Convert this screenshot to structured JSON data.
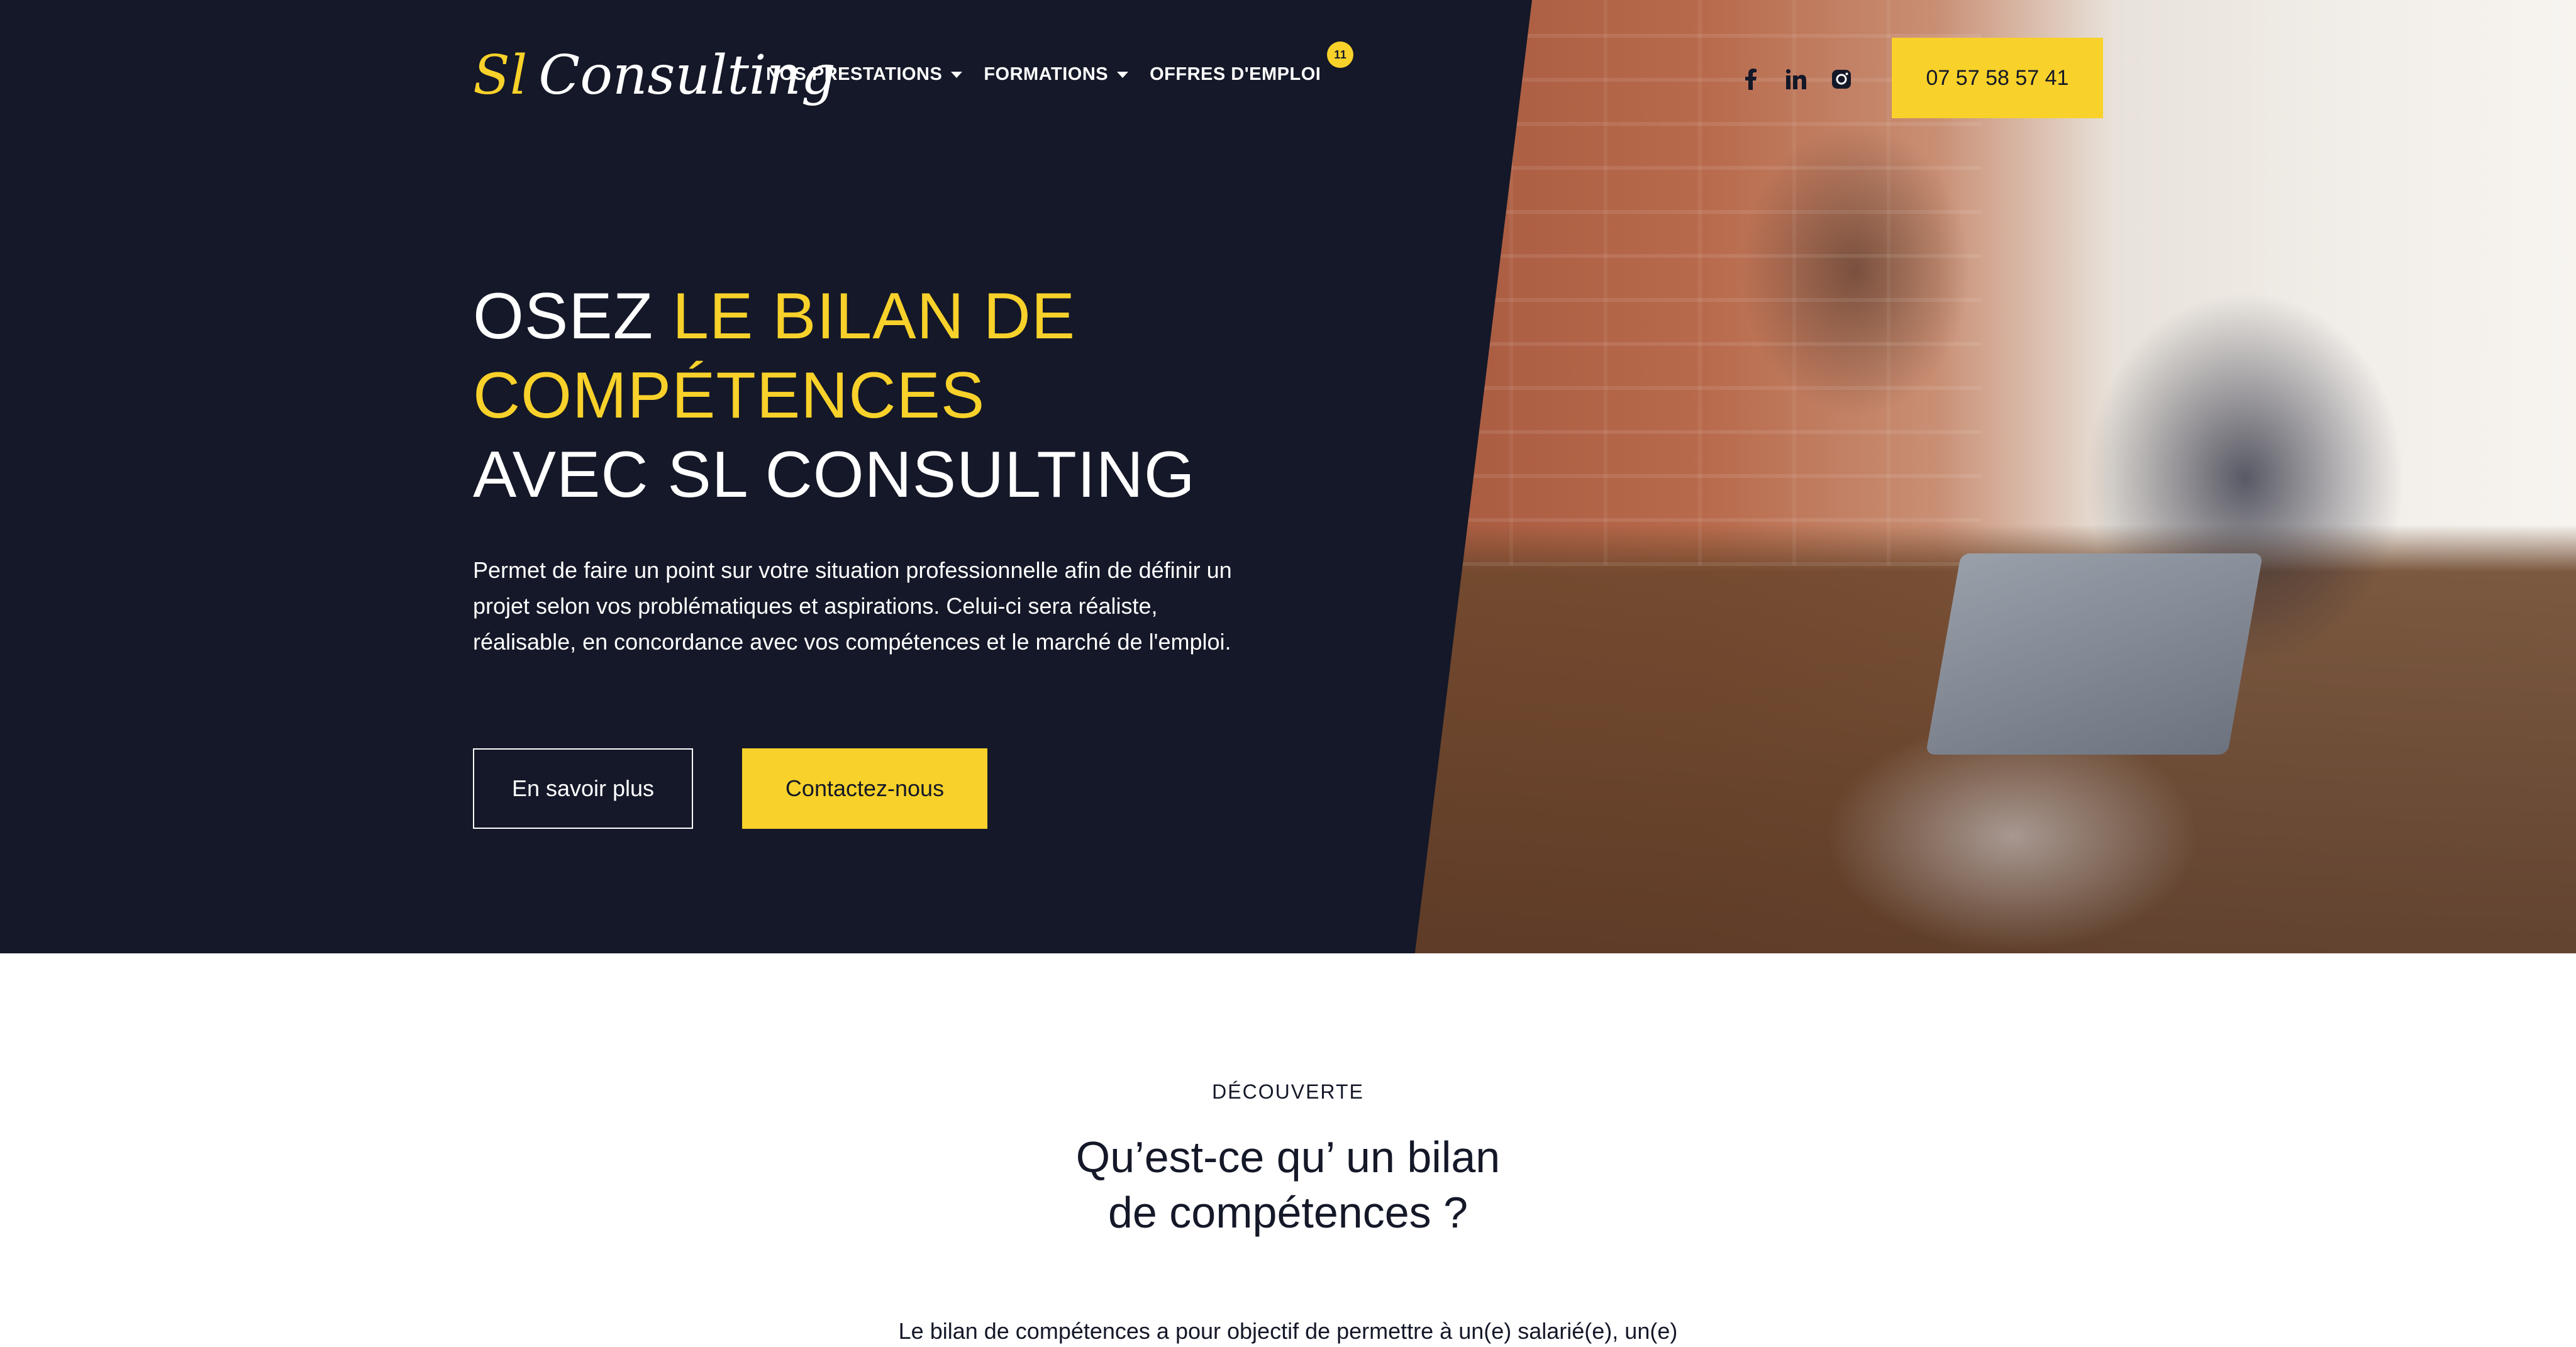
{
  "header": {
    "logo": {
      "part1": "Sl",
      "part2": "Consulting"
    },
    "nav": [
      {
        "label": "NOS PRESTATIONS",
        "has_dropdown": true
      },
      {
        "label": "FORMATIONS",
        "has_dropdown": true
      },
      {
        "label": "OFFRES D'EMPLOI",
        "has_dropdown": false,
        "badge": "11"
      }
    ],
    "socials": [
      "facebook-icon",
      "linkedin-icon",
      "instagram-icon"
    ],
    "phone": "07 57 58 57 41"
  },
  "hero": {
    "title_part1": "OSEZ ",
    "title_highlight_line1": "LE BILAN DE",
    "title_highlight_line2": "COMPÉTENCES",
    "title_line3": "AVEC SL CONSULTING",
    "description": "Permet de faire un point sur votre situation professionnelle afin de définir un projet selon vos problématiques et aspirations. Celui-ci sera réaliste, réalisable, en concordance avec vos compétences et le marché de l'emploi.",
    "btn_secondary": "En savoir plus",
    "btn_primary": "Contactez-nous"
  },
  "section": {
    "eyebrow": "DÉCOUVERTE",
    "title_line1": "Qu’est-ce qu’ un bilan",
    "title_line2": "de compétences ?",
    "text": "Le bilan de compétences a pour objectif de permettre à un(e) salarié(e), un(e)"
  },
  "colors": {
    "background_dark": "#141828",
    "accent": "#f8d12a",
    "text_light": "#ffffff"
  }
}
